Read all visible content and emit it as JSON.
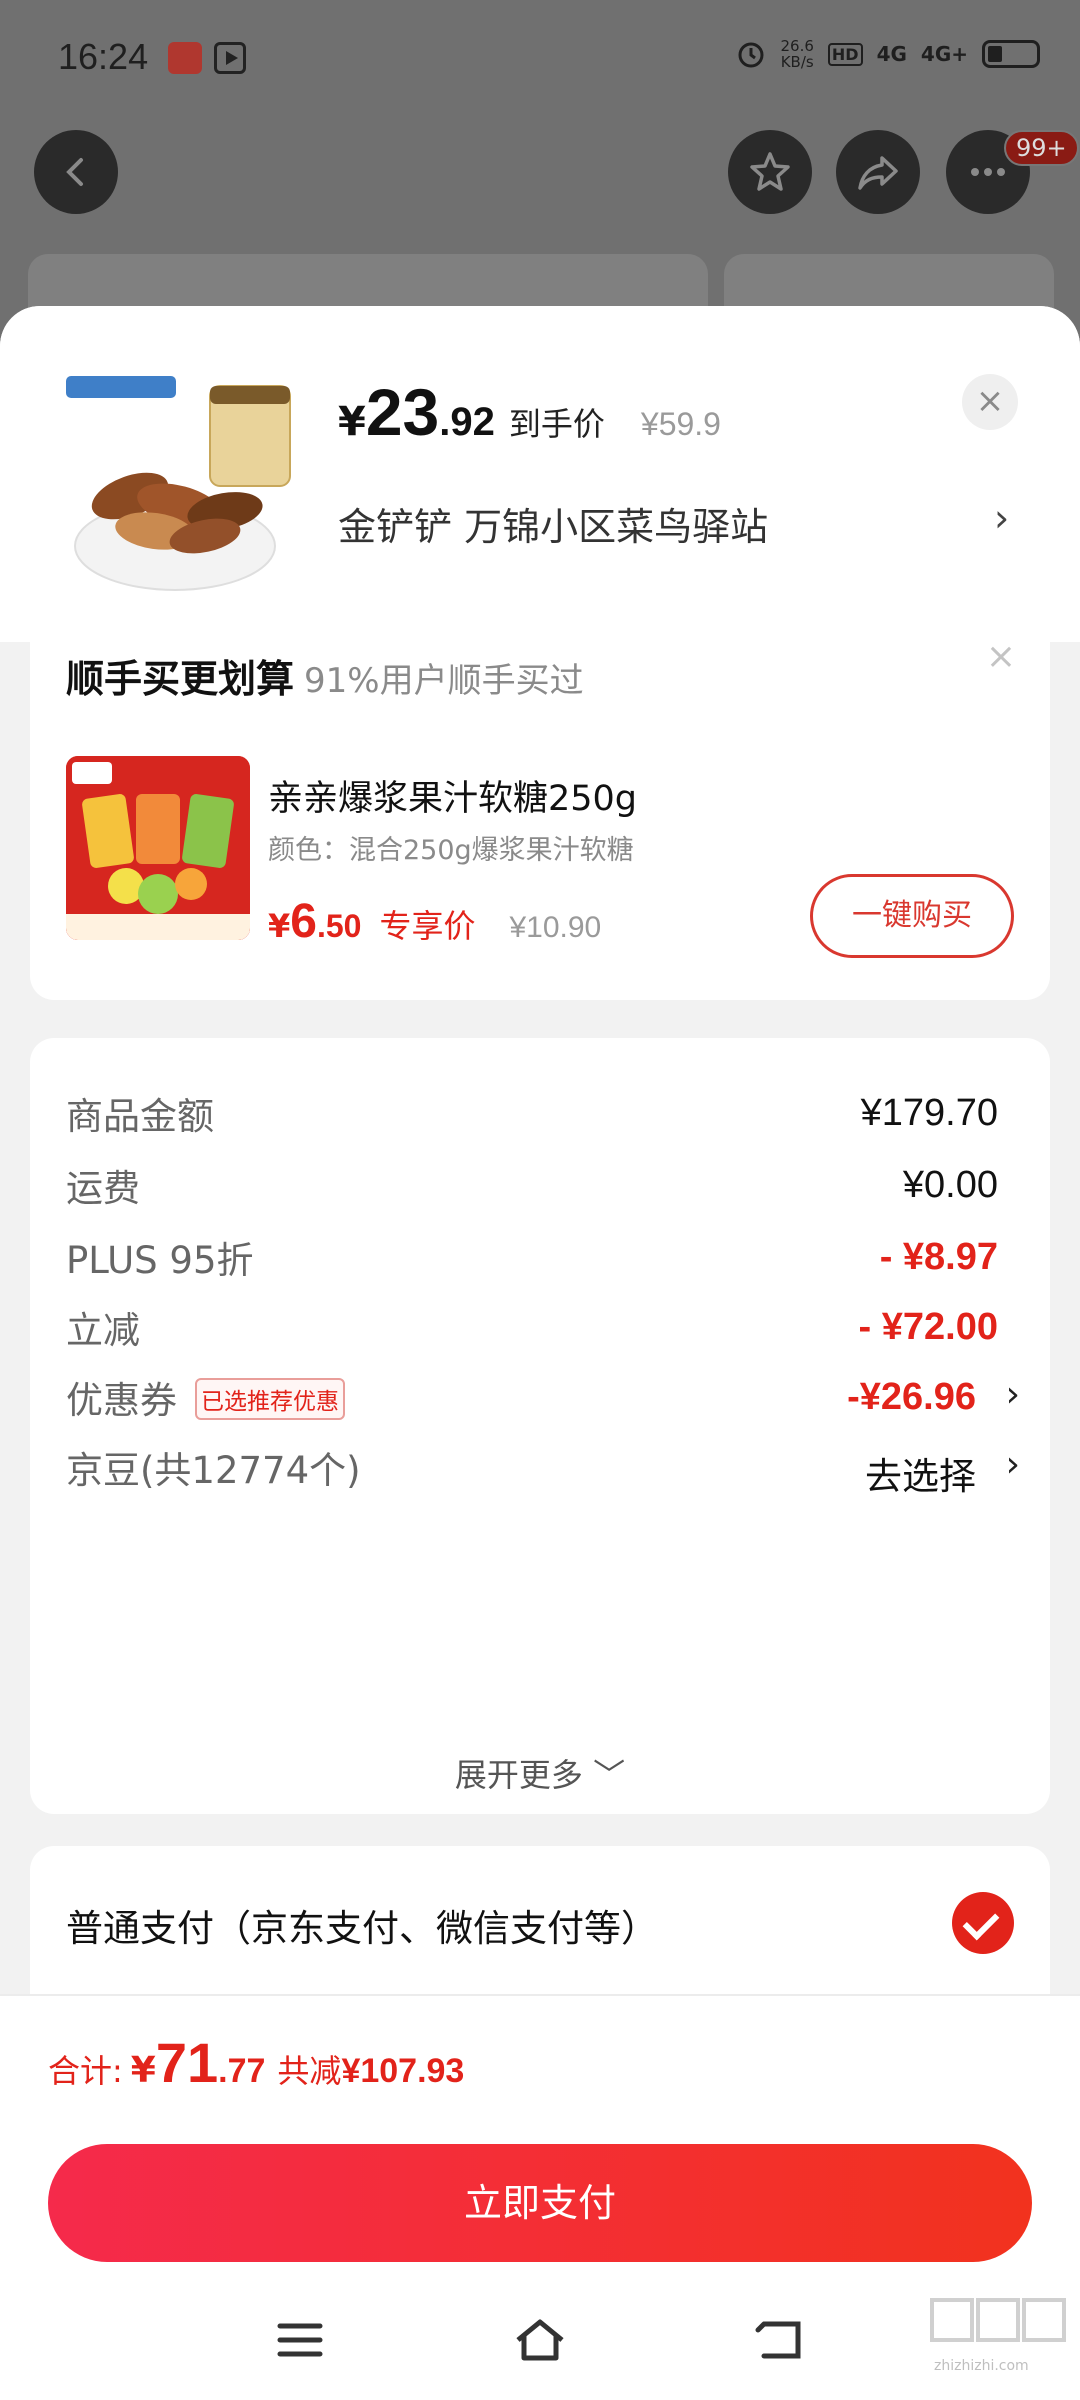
{
  "status_bar": {
    "time": "16:24",
    "net_speed_value": "26.6",
    "net_speed_unit": "KB/s",
    "hd": "HD",
    "net1": "4G",
    "net2": "4G+"
  },
  "top_nav": {
    "more_badge": "99+"
  },
  "product": {
    "currency": "¥",
    "price_int": "23",
    "price_dec": ".92",
    "price_tag": "到手价",
    "orig_price": "¥59.9",
    "address": "金铲铲  万锦小区菜鸟驿站",
    "address_arrow": "›",
    "close": "×"
  },
  "upsell": {
    "title": "顺手买更划算",
    "subtitle": "91%用户顺手买过",
    "close": "×",
    "item_name": "亲亲爆浆果汁软糖250g",
    "item_spec": "颜色：混合250g爆浆果汁软糖",
    "currency": "¥",
    "price_int": "6",
    "price_dec": ".50",
    "price_tag": "专享价",
    "orig_price": "¥10.90",
    "buy_label": "一键购买"
  },
  "summary": {
    "rows": [
      {
        "label": "商品金额",
        "value": "¥179.70"
      },
      {
        "label": "运费",
        "value": "¥0.00"
      },
      {
        "label": "PLUS 95折",
        "value": "- ¥8.97"
      },
      {
        "label": "立减",
        "value": "- ¥72.00"
      },
      {
        "label": "优惠券",
        "tag": "已选推荐优惠",
        "value": "-¥26.96"
      },
      {
        "label": "京豆(共12774个)",
        "value": "去选择"
      }
    ],
    "arrow": "›",
    "expand": "展开更多 ﹀"
  },
  "payment": {
    "method": "普通支付（京东支付、微信支付等）"
  },
  "footer": {
    "total_label": "合计:",
    "currency": "¥",
    "total_int": "71",
    "total_dec": ".77",
    "save_label": "共减",
    "save_value": "¥107.93",
    "pay_button": "立即支付"
  },
  "watermark": "zhizhizhi.com",
  "colors": {
    "accent": "#e2231a",
    "pay_gradient_start": "#f52a4b",
    "pay_gradient_end": "#f2321e"
  }
}
